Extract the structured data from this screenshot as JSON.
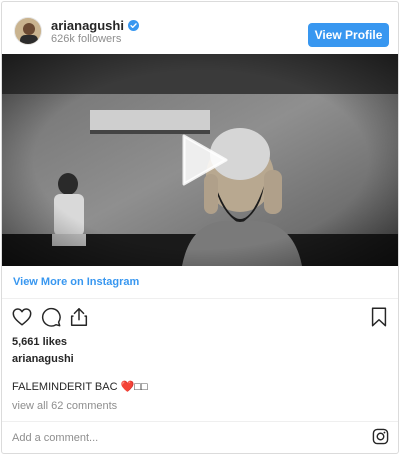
{
  "header": {
    "username": "arianagushi",
    "followers": "626k followers",
    "view_profile_label": "View Profile",
    "verified": true
  },
  "media": {
    "type": "video",
    "play_icon": "play-icon"
  },
  "view_more_label": "View More on Instagram",
  "actions": {
    "like_icon": "heart-icon",
    "comment_icon": "comment-icon",
    "share_icon": "share-icon",
    "save_icon": "bookmark-icon"
  },
  "likes": "5,661 likes",
  "owner": "arianagushi",
  "caption": "FALEMINDERIT BAC ❤️□□",
  "view_comments": "view all 62 comments",
  "comment_placeholder": "Add a comment...",
  "colors": {
    "accent": "#3897f0",
    "text": "#262626",
    "muted": "#8e8e8e",
    "border": "#dbdbdb"
  }
}
